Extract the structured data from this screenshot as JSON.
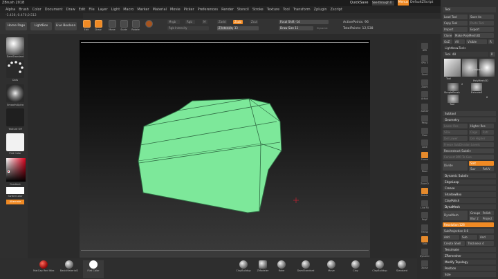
{
  "app": {
    "title": "ZBrush 2018",
    "quicksave": "QuickSave",
    "seethrough": "See-through  0",
    "menus_btn": "Menus",
    "script": "DefaultZScript"
  },
  "menubar": [
    "Alpha",
    "Brush",
    "Color",
    "Document",
    "Draw",
    "Edit",
    "File",
    "Layer",
    "Light",
    "Macro",
    "Marker",
    "Material",
    "Movie",
    "Picker",
    "Preferences",
    "Render",
    "Stencil",
    "Stroke",
    "Texture",
    "Tool",
    "Transform",
    "Zplugin",
    "Zscript"
  ],
  "coords": "-1.436,-0.470,0.512",
  "toolbar": {
    "home": "Home Page",
    "lightbox": "LightBox",
    "live_boolean": "Live Boolean",
    "edit": "Edit",
    "draw": "Draw",
    "move": "Move",
    "scale": "Scale",
    "rotate": "Rotate",
    "mrgb": "Mrgb",
    "rgb": "Rgb",
    "m": "M",
    "zadd": "Zadd",
    "zsub": "Zsub",
    "zcut": "Zcut",
    "rgb_intensity": "Rgb Intensity",
    "z_intensity": "Z Intensity 33",
    "focal_shift": "Focal Shift -14",
    "draw_size": "Draw Size 11",
    "dynamic": "Dynamic",
    "active_points": "ActivePoints: 96",
    "total_points": "TotalPoints: 12,538"
  },
  "left_shelf": {
    "brush": "DamStandard",
    "stroke": "Dots",
    "alpha": "SmoothAlpha",
    "texture": "Texture Off",
    "material": "Flat Color",
    "gradient": "Gradient",
    "switch": "SwitchColor",
    "alternate": "Alternate"
  },
  "right_shelf": [
    "BPR",
    "SPix 3",
    "Scroll",
    "Zoom",
    "Actual",
    "AAHalf",
    "Persp",
    "Floor",
    "Local",
    "Frame",
    "Move",
    "ZoomD",
    "Rotate",
    "Line Fill",
    "PolyF",
    "Transp",
    "Solo",
    "Dynamic",
    "Xpose"
  ],
  "panel": {
    "tool": "Tool",
    "load_tool": "Load Tool",
    "save_as": "Save As",
    "copy_tool": "Copy Tool",
    "paste_tool": "Paste Tool",
    "import": "Import",
    "export": "Export",
    "clone": "Clone",
    "make_polymesh": "Make PolyMesh3D",
    "goz": "GoZ",
    "all": "All",
    "visible": "Visible",
    "r": "R",
    "lightbox_tools": "Lightbox▸Tools",
    "tool_count": "Tool. 48",
    "r2": "R",
    "tools": [
      "Tool",
      "Cylinder3D",
      "PolyMesh3D",
      "SimpleBrush",
      "Extrude3",
      "Tool"
    ],
    "num_2": "2",
    "num_6": "6",
    "subtool": "Subtool",
    "geometry": "Geometry",
    "lower_res": "Lower Res",
    "higher_res": "Higher Res",
    "sdiv": "SDiv",
    "cage": "Cage",
    "rstr": "Rstr",
    "del_lower": "Del Lower",
    "del_higher": "Del Higher",
    "freeze": "Freeze SubDivision Levels",
    "reconstruct": "Reconstruct Subdiv",
    "convert": "Convert BPR To Geo",
    "divide": "Divide",
    "smt": "Smt",
    "suv": "Suv",
    "rsuv": "ReUV",
    "dynamic_subdiv": "Dynamic Subdiv",
    "edgeloop": "EdgeLoop",
    "crease": "Crease",
    "shadowbox": "ShadowBox",
    "claypolish": "ClayPolish",
    "dynamesh_h": "DynaMesh",
    "dynamesh": "DynaMesh",
    "groups": "Groups",
    "polish": "Polish",
    "blur": "Blur 2",
    "project": "Project",
    "resolution": "Resolution 128",
    "subprojection": "SubProjection 0.6",
    "add": "Add",
    "sub": "Sub",
    "and": "And",
    "create_shell": "Create Shell",
    "thickness": "Thickness 4",
    "tessimate": "Tessimate",
    "zremesher": "ZRemesher",
    "modify_topology": "Modify Topology",
    "position": "Position",
    "size": "Size"
  },
  "bottom": {
    "matcap": "MatCap Red Wax",
    "basic_material": "BasicMaterial2",
    "flat_color": "Flat Color",
    "brushes": [
      "ClayBuildup",
      "ZModeler",
      "Rake",
      "DamStandard",
      "Move",
      "Clay",
      "ClayBuildup",
      "Standard"
    ]
  },
  "colors": {
    "accent": "#f08a24",
    "mesh": "#7de89a",
    "viewport_bg": "#1a1a1a"
  }
}
